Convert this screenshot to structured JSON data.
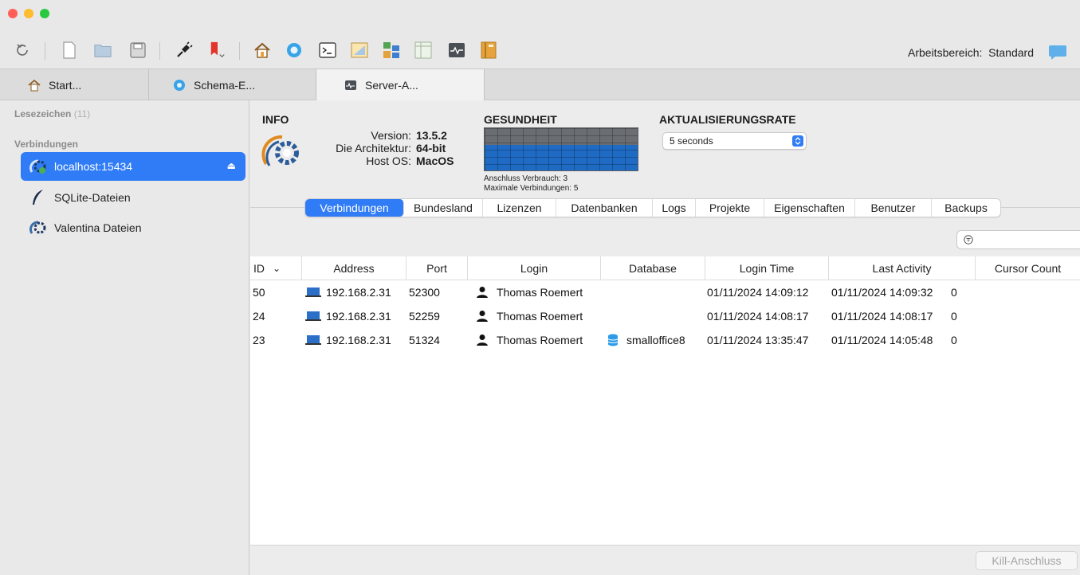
{
  "toolbar": {
    "workspace_label": "Arbeitsbereich:",
    "workspace_value": "Standard",
    "icons": [
      "refresh-icon",
      "new-document-icon",
      "folder-icon",
      "save-icon",
      "connect-plug-icon",
      "bookmark-icon",
      "home-icon",
      "schema-editor-icon",
      "terminal-icon",
      "sql-editor-icon",
      "diagram-icon",
      "table-icon",
      "server-admin-icon",
      "reports-book-icon",
      "chat-icon"
    ]
  },
  "tabs": [
    {
      "label": "Start...",
      "icon": "home-icon"
    },
    {
      "label": "Schema-E...",
      "icon": "schema-editor-icon"
    },
    {
      "label": "Server-A...",
      "icon": "server-admin-icon",
      "active": true
    }
  ],
  "sidebar": {
    "bookmarks_label": "Lesezeichen",
    "bookmarks_count": "(11)",
    "connections_label": "Verbindungen",
    "items": [
      {
        "label": "localhost:15434",
        "icon": "valentina-server-icon",
        "selected": true
      },
      {
        "label": "SQLite-Dateien",
        "icon": "sqlite-feather-icon"
      },
      {
        "label": "Valentina Dateien",
        "icon": "valentina-icon"
      }
    ]
  },
  "info": {
    "title": "INFO",
    "version_label": "Version:",
    "version_value": "13.5.2",
    "arch_label": "Die Architektur:",
    "arch_value": "64-bit",
    "os_label": "Host OS:",
    "os_value": "MacOS"
  },
  "health": {
    "title": "GESUNDHEIT",
    "connections_used_text": "Anschluss Verbrauch: 3",
    "max_connections_text": "Maximale Verbindungen: 5",
    "used": 3,
    "max": 5
  },
  "refresh": {
    "title": "AKTUALISIERUNGSRATE",
    "selected": "5 seconds"
  },
  "subtabs": [
    {
      "label": "Verbindungen",
      "active": true
    },
    {
      "label": "Bundesland"
    },
    {
      "label": "Lizenzen"
    },
    {
      "label": "Datenbanken"
    },
    {
      "label": "Logs"
    },
    {
      "label": "Projekte"
    },
    {
      "label": "Eigenschaften"
    },
    {
      "label": "Benutzer"
    },
    {
      "label": "Backups"
    }
  ],
  "table": {
    "columns": [
      "ID",
      "Address",
      "Port",
      "Login",
      "Database",
      "Login Time",
      "Last Activity",
      "Cursor Count"
    ],
    "sort_indicator": "⌄",
    "rows": [
      {
        "id": "50",
        "address": "192.168.2.31",
        "port": "52300",
        "login": "Thomas Roemert",
        "database": "",
        "login_time": "01/11/2024 14:09:12",
        "last_activity": "01/11/2024 14:09:32",
        "cursor_count": "0"
      },
      {
        "id": "24",
        "address": "192.168.2.31",
        "port": "52259",
        "login": "Thomas Roemert",
        "database": "",
        "login_time": "01/11/2024 14:08:17",
        "last_activity": "01/11/2024 14:08:17",
        "cursor_count": "0"
      },
      {
        "id": "23",
        "address": "192.168.2.31",
        "port": "51324",
        "login": "Thomas Roemert",
        "database": "smalloffice8",
        "login_time": "01/11/2024 13:35:47",
        "last_activity": "01/11/2024 14:05:48",
        "cursor_count": "0"
      }
    ]
  },
  "footer": {
    "kill_button": "Kill-Anschluss"
  },
  "colors": {
    "accent": "#2f7cf6",
    "health_fill": "#1f6bc4",
    "health_empty": "#6a6e73"
  }
}
